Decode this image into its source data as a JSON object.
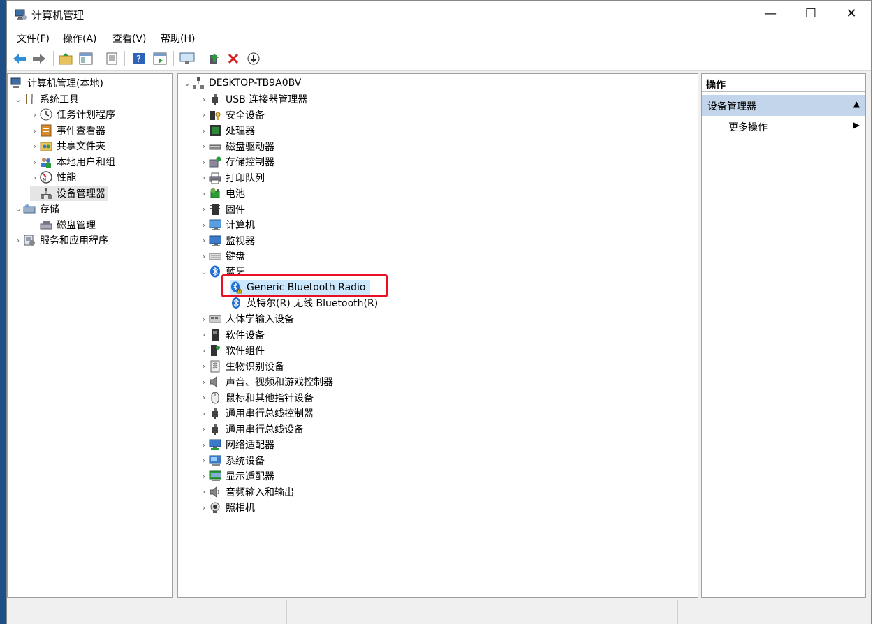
{
  "window": {
    "title": "计算机管理"
  },
  "menu": [
    "文件(F)",
    "操作(A)",
    "查看(V)",
    "帮助(H)"
  ],
  "toolbar": [
    "back-icon",
    "forward-icon",
    "up-folder-icon",
    "show-hide-tree-icon",
    "properties-icon",
    "help-icon",
    "action-pane-icon",
    "monitor-icon",
    "update-driver-icon",
    "uninstall-icon",
    "download-icon"
  ],
  "left_tree": {
    "root": "计算机管理(本地)",
    "system_tools": "系统工具",
    "task_scheduler": "任务计划程序",
    "event_viewer": "事件查看器",
    "shared_folders": "共享文件夹",
    "local_users": "本地用户和组",
    "performance": "性能",
    "device_manager": "设备管理器",
    "storage": "存储",
    "disk_management": "磁盘管理",
    "services": "服务和应用程序"
  },
  "devices": {
    "computer": "DESKTOP-TB9A0BV",
    "categories": [
      {
        "label": "USB 连接器管理器",
        "icon": "usb-icon"
      },
      {
        "label": "安全设备",
        "icon": "security-device-icon"
      },
      {
        "label": "处理器",
        "icon": "processor-icon"
      },
      {
        "label": "磁盘驱动器",
        "icon": "disk-drive-icon"
      },
      {
        "label": "存储控制器",
        "icon": "storage-controller-icon"
      },
      {
        "label": "打印队列",
        "icon": "printer-icon"
      },
      {
        "label": "电池",
        "icon": "battery-icon"
      },
      {
        "label": "固件",
        "icon": "firmware-icon"
      },
      {
        "label": "计算机",
        "icon": "computer-icon"
      },
      {
        "label": "监视器",
        "icon": "monitor-icon"
      },
      {
        "label": "键盘",
        "icon": "keyboard-icon"
      }
    ],
    "bluetooth": {
      "label": "蓝牙",
      "children": [
        "Generic Bluetooth Radio",
        "英特尔(R) 无线 Bluetooth(R)"
      ]
    },
    "categories_after": [
      {
        "label": "人体学输入设备",
        "icon": "hid-icon"
      },
      {
        "label": "软件设备",
        "icon": "software-device-icon"
      },
      {
        "label": "软件组件",
        "icon": "software-component-icon"
      },
      {
        "label": "生物识别设备",
        "icon": "biometric-icon"
      },
      {
        "label": "声音、视频和游戏控制器",
        "icon": "speaker-icon"
      },
      {
        "label": "鼠标和其他指针设备",
        "icon": "mouse-icon"
      },
      {
        "label": "通用串行总线控制器",
        "icon": "usb-controller-icon"
      },
      {
        "label": "通用串行总线设备",
        "icon": "usb-device-icon"
      },
      {
        "label": "网络适配器",
        "icon": "network-adapter-icon"
      },
      {
        "label": "系统设备",
        "icon": "system-device-icon"
      },
      {
        "label": "显示适配器",
        "icon": "display-adapter-icon"
      },
      {
        "label": "音频输入和输出",
        "icon": "audio-io-icon"
      },
      {
        "label": "照相机",
        "icon": "camera-icon"
      }
    ]
  },
  "actions": {
    "header": "操作",
    "section": "设备管理器",
    "more": "更多操作"
  },
  "colors": {
    "highlight_box": "#e81123",
    "selection": "#cce8ff",
    "action_section": "#c2d5ea"
  }
}
